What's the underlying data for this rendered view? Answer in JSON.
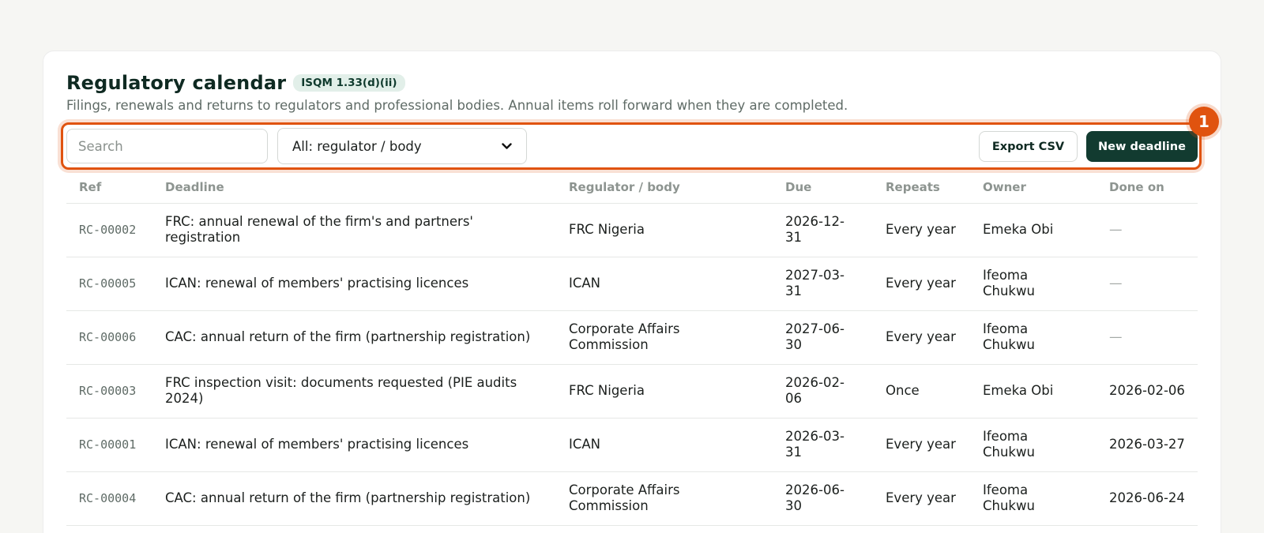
{
  "header": {
    "title": "Regulatory calendar",
    "badge": "ISQM 1.33(d)(ii)",
    "subtitle": "Filings, renewals and returns to regulators and professional bodies. Annual items roll forward when they are completed."
  },
  "callout": {
    "number": "1"
  },
  "toolbar": {
    "search_placeholder": "Search",
    "filter_value": "All: regulator / body",
    "export_label": "Export CSV",
    "new_label": "New deadline"
  },
  "table": {
    "columns": [
      "Ref",
      "Deadline",
      "Regulator / body",
      "Due",
      "Repeats",
      "Owner",
      "Done on"
    ],
    "rows": [
      [
        "RC-00002",
        "FRC: annual renewal of the firm's and partners' registration",
        "FRC Nigeria",
        "2026-12-31",
        "Every year",
        "Emeka Obi",
        "—"
      ],
      [
        "RC-00005",
        "ICAN: renewal of members' practising licences",
        "ICAN",
        "2027-03-31",
        "Every year",
        "Ifeoma Chukwu",
        "—"
      ],
      [
        "RC-00006",
        "CAC: annual return of the firm (partnership registration)",
        "Corporate Affairs Commission",
        "2027-06-30",
        "Every year",
        "Ifeoma Chukwu",
        "—"
      ],
      [
        "RC-00003",
        "FRC inspection visit: documents requested (PIE audits 2024)",
        "FRC Nigeria",
        "2026-02-06",
        "Once",
        "Emeka Obi",
        "2026-02-06"
      ],
      [
        "RC-00001",
        "ICAN: renewal of members' practising licences",
        "ICAN",
        "2026-03-31",
        "Every year",
        "Ifeoma Chukwu",
        "2026-03-27"
      ],
      [
        "RC-00004",
        "CAC: annual return of the firm (partnership registration)",
        "Corporate Affairs Commission",
        "2026-06-30",
        "Every year",
        "Ifeoma Chukwu",
        "2026-06-24"
      ]
    ]
  },
  "colors": {
    "accent": "#e0530f",
    "primary_button": "#123b30",
    "badge_bg": "#e2efe9"
  }
}
